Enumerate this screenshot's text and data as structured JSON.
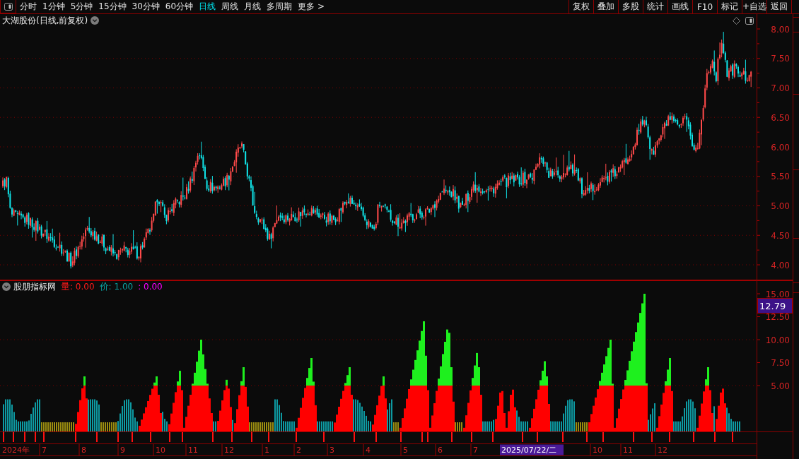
{
  "toolbar": {
    "tabs": [
      {
        "label": "分时",
        "selected": false
      },
      {
        "label": "1分钟",
        "selected": false
      },
      {
        "label": "5分钟",
        "selected": false
      },
      {
        "label": "15分钟",
        "selected": false
      },
      {
        "label": "30分钟",
        "selected": false
      },
      {
        "label": "60分钟",
        "selected": false
      },
      {
        "label": "日线",
        "selected": true
      },
      {
        "label": "周线",
        "selected": false
      },
      {
        "label": "月线",
        "selected": false
      },
      {
        "label": "多周期",
        "selected": false
      },
      {
        "label": "更多 >",
        "selected": false
      }
    ],
    "buttons": [
      "复权",
      "叠加",
      "多股",
      "统计",
      "画线",
      "F10",
      "标记",
      "+自选",
      "返回"
    ]
  },
  "price_chart": {
    "title": "大湖股份(日线,前复权)",
    "axis_ticks": [
      "8.00",
      "7.50",
      "7.00",
      "6.50",
      "6.00",
      "5.50",
      "5.00",
      "4.50",
      "4.00"
    ]
  },
  "indicator": {
    "name": "股朋指标网",
    "legend": [
      {
        "label": "量",
        "value": ": 0.00",
        "color": "#ff1a1a"
      },
      {
        "label": "价",
        "value": ": 1.00",
        "color": "#0aa0a0"
      },
      {
        "value": ": 0.00",
        "color": "#ff00ff"
      }
    ],
    "axis_ticks": [
      "15.00",
      "12.50",
      "10.00",
      "7.50",
      "5.00"
    ],
    "current_value": "12.79"
  },
  "time_axis": {
    "labels": [
      {
        "label": "2024年",
        "kind": "tick"
      },
      {
        "label": "7",
        "kind": "tick"
      },
      {
        "label": "8",
        "kind": "tick"
      },
      {
        "label": "9",
        "kind": "tick"
      },
      {
        "label": "10",
        "kind": "tick"
      },
      {
        "label": "11",
        "kind": "tick"
      },
      {
        "label": "12",
        "kind": "tick"
      },
      {
        "label": "1",
        "kind": "tick"
      },
      {
        "label": "2",
        "kind": "tick"
      },
      {
        "label": "3",
        "kind": "tick"
      },
      {
        "label": "4",
        "kind": "tick"
      },
      {
        "label": "5",
        "kind": "tick"
      },
      {
        "label": "6",
        "kind": "tick"
      },
      {
        "label": "7",
        "kind": "tick"
      },
      {
        "label": "2025/07/22/二",
        "kind": "cursor"
      },
      {
        "label": "10",
        "kind": "tick"
      },
      {
        "label": "11",
        "kind": "tick"
      },
      {
        "label": "12",
        "kind": "tick"
      }
    ]
  }
}
